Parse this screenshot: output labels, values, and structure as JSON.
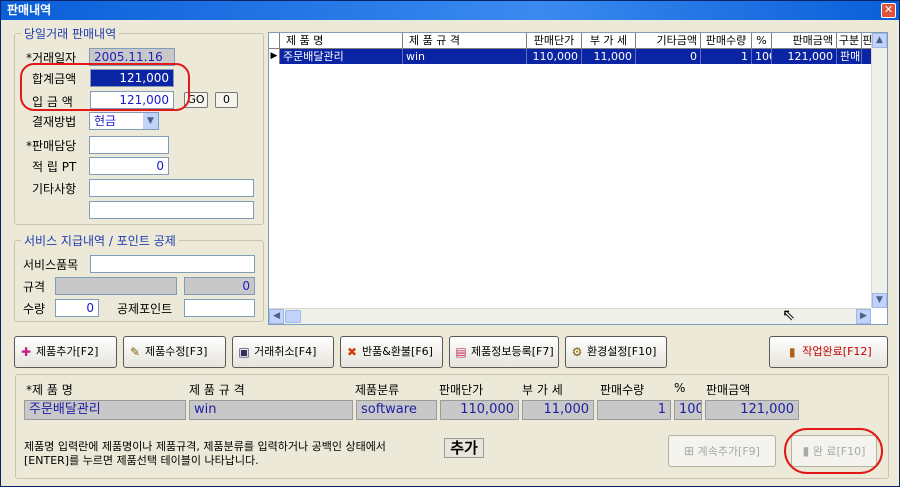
{
  "window": {
    "title": "판매내역",
    "close": "✕"
  },
  "sale": {
    "group_title": "당일거래 판매내역",
    "date_label": "*거래일자",
    "date_value": "2005.11.16",
    "total_label": "합계금액",
    "total_value": "121,000",
    "deposit_label": "입 금 액",
    "deposit_value": "121,000",
    "go_btn": "GO",
    "zero_btn": "0",
    "payment_label": "결재방법",
    "payment_value": "현금",
    "staff_label": "*판매담당",
    "staff_value": "",
    "points_label": "적 립 PT",
    "points_value": "0",
    "other_label": "기타사항",
    "other_value1": "",
    "other_value2": ""
  },
  "service": {
    "group_title": "서비스 지급내역 / 포인트 공제",
    "item_label": "서비스품목",
    "item_value": "",
    "spec_label": "규격",
    "spec_value": "",
    "spec_value2": "0",
    "qty_label": "수량",
    "qty_value": "0",
    "deduct_label": "공제포인트",
    "deduct_value": ""
  },
  "grid": {
    "headers": [
      "제 품 명",
      "제 품 규 격",
      "판매단가",
      "부 가 세",
      "기타금액",
      "판매수량",
      "%",
      "판매금액",
      "구분",
      "판"
    ],
    "row": [
      "주문배달관리",
      "win",
      "110,000",
      "11,000",
      "0",
      "1",
      "100",
      "121,000",
      "판매"
    ]
  },
  "toolbar": {
    "add": "제품추가[F2]",
    "edit": "제품수정[F3]",
    "cancel": "거래취소[F4]",
    "return": "반품&환불[F6]",
    "register": "제품정보등록[F7]",
    "settings": "환경설정[F10]",
    "finish": "작업완료[F12]"
  },
  "entry": {
    "headers": [
      "*제 품 명",
      "제 품 규 격",
      "제품분류",
      "판매단가",
      "부 가 세",
      "판매수량",
      "%",
      "판매금액"
    ],
    "values": [
      "주문배달관리",
      "win",
      "software",
      "110,000",
      "11,000",
      "1",
      "100",
      "121,000"
    ],
    "note_line1": "제품명 입력란에 제품명이나 제품규격, 제품분류를 입력하거나 공백인 상태에서",
    "note_line2": "[ENTER]를 누르면 제품선택 테이블이 나타납니다.",
    "add_label": "추가",
    "continue_btn": "계속추가[F9]",
    "complete_btn": "완 료[F10]"
  },
  "colors": {
    "title_bar": "#0a5ed8",
    "selection": "#0a24a4",
    "highlight": "#e01818"
  }
}
